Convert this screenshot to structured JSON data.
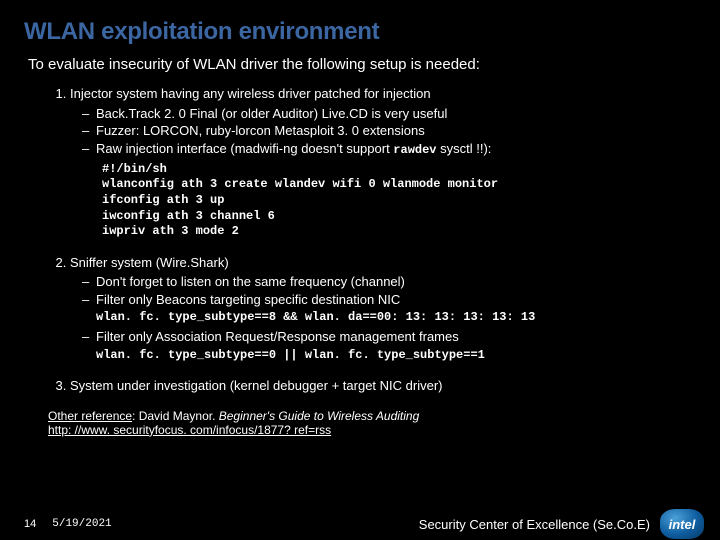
{
  "title": "WLAN exploitation environment",
  "subtitle": "To evaluate insecurity of WLAN driver the following setup is needed:",
  "item1": {
    "text": "Injector system having any wireless driver patched for injection",
    "a": "Back.Track 2. 0 Final (or older Auditor) Live.CD is very useful",
    "b": "Fuzzer: LORCON, ruby-lorcon Metasploit 3. 0 extensions",
    "c_prefix": "Raw injection interface (madwifi-ng doesn't support ",
    "c_code": "rawdev",
    "c_suffix": " sysctl !!):",
    "code": {
      "l1": "#!/bin/sh",
      "l2": "wlanconfig ath 3 create wlandev wifi 0 wlanmode monitor",
      "l3": "ifconfig ath 3 up",
      "l4": "iwconfig ath 3 channel 6",
      "l5": "iwpriv ath 3 mode 2"
    }
  },
  "item2": {
    "text": "Sniffer system (Wire.Shark)",
    "a": "Don't forget to listen on the same frequency (channel)",
    "b": "Filter only Beacons targeting specific destination NIC",
    "code_b": "wlan. fc. type_subtype==8 && wlan. da==00: 13: 13: 13: 13: 13",
    "c": "Filter only Association Request/Response management frames",
    "code_c": "wlan. fc. type_subtype==0 || wlan. fc. type_subtype==1"
  },
  "item3": {
    "text": "System under investigation (kernel debugger + target NIC driver)"
  },
  "refs": {
    "label": "Other reference",
    "author": ": David Maynor. ",
    "title": "Beginner's Guide to Wireless Auditing",
    "url": "http: //www. securityfocus. com/infocus/1877? ref=rss"
  },
  "footer": {
    "page": "14",
    "date": "5/19/2021",
    "right": "Security Center of Excellence (Se.Co.E)",
    "logo_text": "intel"
  }
}
